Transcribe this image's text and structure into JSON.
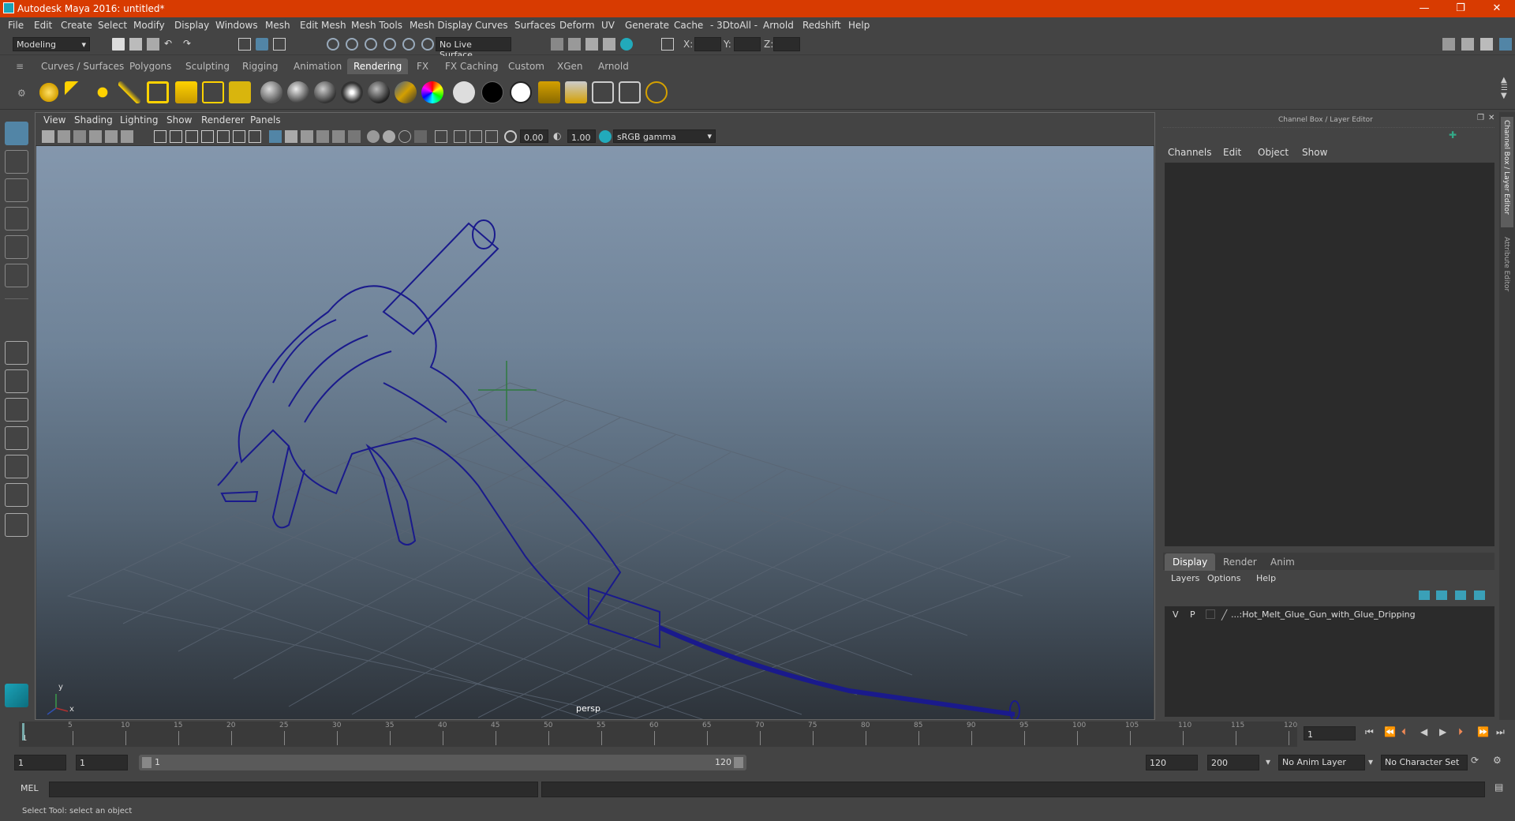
{
  "window": {
    "title": "Autodesk Maya 2016: untitled*",
    "minimize": "—",
    "maximize": "❐",
    "close": "✕"
  },
  "menubar": [
    "File",
    "Edit",
    "Create",
    "Select",
    "Modify",
    "Display",
    "Windows",
    "Mesh",
    "Edit Mesh",
    "Mesh Tools",
    "Mesh Display",
    "Curves",
    "Surfaces",
    "Deform",
    "UV",
    "Generate",
    "Cache",
    "- 3DtoAll -",
    "Arnold",
    "Redshift",
    "Help"
  ],
  "statusline": {
    "mode": "Modeling",
    "live_surface": "No Live Surface",
    "x_label": "X:",
    "y_label": "Y:",
    "z_label": "Z:"
  },
  "shelf_tabs": [
    "Curves / Surfaces",
    "Polygons",
    "Sculpting",
    "Rigging",
    "Animation",
    "Rendering",
    "FX",
    "FX Caching",
    "Custom",
    "XGen",
    "Arnold"
  ],
  "shelf_active_tab": "Rendering",
  "panel_menu": [
    "View",
    "Shading",
    "Lighting",
    "Show",
    "Renderer",
    "Panels"
  ],
  "panel_toolbar": {
    "exposure": "0.00",
    "gamma": "1.00",
    "color_space": "sRGB gamma"
  },
  "viewport": {
    "camera": "persp",
    "axis_x": "x",
    "axis_y": "y",
    "bg_top": "#8497ad",
    "wire_color": "#1a1a8c"
  },
  "channel_box": {
    "title": "Channel Box / Layer Editor",
    "menu": [
      "Channels",
      "Edit",
      "Object",
      "Show"
    ]
  },
  "layer_editor": {
    "tabs": [
      "Display",
      "Render",
      "Anim"
    ],
    "active_tab": "Display",
    "menu": [
      "Layers",
      "Options",
      "Help"
    ],
    "layer_v": "V",
    "layer_p": "P",
    "layer_name": "...:Hot_Melt_Glue_Gun_with_Glue_Dripping"
  },
  "side_tabs": {
    "channel": "Channel Box / Layer Editor",
    "attribute": "Attribute Editor"
  },
  "timeline": {
    "ticks": [
      "5",
      "10",
      "15",
      "20",
      "25",
      "30",
      "35",
      "40",
      "45",
      "50",
      "55",
      "60",
      "65",
      "70",
      "75",
      "80",
      "85",
      "90",
      "95",
      "100",
      "105",
      "110",
      "115",
      "120"
    ],
    "start_label": "1",
    "current_frame": "1"
  },
  "range": {
    "start": "1",
    "inner_start": "1",
    "slider_start": "1",
    "slider_end": "120",
    "end": "120",
    "total_end": "200",
    "anim_layer": "No Anim Layer",
    "char_set": "No Character Set"
  },
  "cmdline": {
    "label": "MEL"
  },
  "help_line": "Select Tool: select an object",
  "colors": {
    "title_bar": "#d83b01",
    "accent": "#5d5d5d"
  }
}
